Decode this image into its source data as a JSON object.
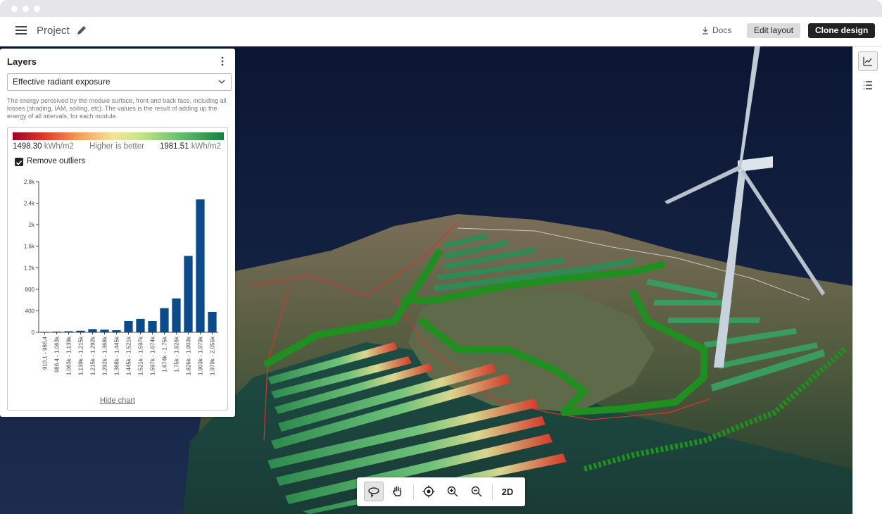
{
  "header": {
    "project_label": "Project",
    "docs_label": "Docs",
    "edit_layout_label": "Edit layout",
    "clone_design_label": "Clone design"
  },
  "layers_panel": {
    "title": "Layers",
    "selected_layer": "Effective radiant exposure",
    "description": "The energy perceived by the module surface, front and back face, including all losses (shading, IAM, soiling, etc). The values is the result of adding up the energy of all intervals, for each module.",
    "legend": {
      "min_value": "1498.30",
      "max_value": "1981.51",
      "unit": "kWh/m2",
      "hint": "Higher is better"
    },
    "remove_outliers_label": "Remove outliers",
    "remove_outliers_checked": true,
    "hide_chart_label": "Hide chart"
  },
  "chart_data": {
    "type": "bar",
    "categories": [
      "910.1 - 986.4",
      "986.4 - 1.063k",
      "1.063k - 1.139k",
      "1.139k - 1.215k",
      "1.215k - 1.292k",
      "1.292k - 1.368k",
      "1.368k - 1.445k",
      "1.445k - 1.521k",
      "1.521k - 1.597k",
      "1.597k - 1.674k",
      "1.674k - 1.75k",
      "1.75k - 1.826k",
      "1.826k - 1.903k",
      "1.903k - 1.979k",
      "1.979k - 2.055k"
    ],
    "values": [
      10,
      15,
      20,
      30,
      60,
      50,
      40,
      210,
      250,
      210,
      450,
      630,
      1420,
      2470,
      380
    ],
    "yticks": [
      "0",
      "400",
      "800",
      "1.2k",
      "1.6k",
      "2k",
      "2.4k",
      "2.8k"
    ],
    "ylim": [
      0,
      2800
    ],
    "grid": false,
    "color": "#0b4a8b"
  },
  "map_toolbar": {
    "mode_2d_label": "2D"
  },
  "colors": {
    "accent_dark": "#222222",
    "bar": "#0b4a8b",
    "scene_sky": "#0f1d3a"
  }
}
